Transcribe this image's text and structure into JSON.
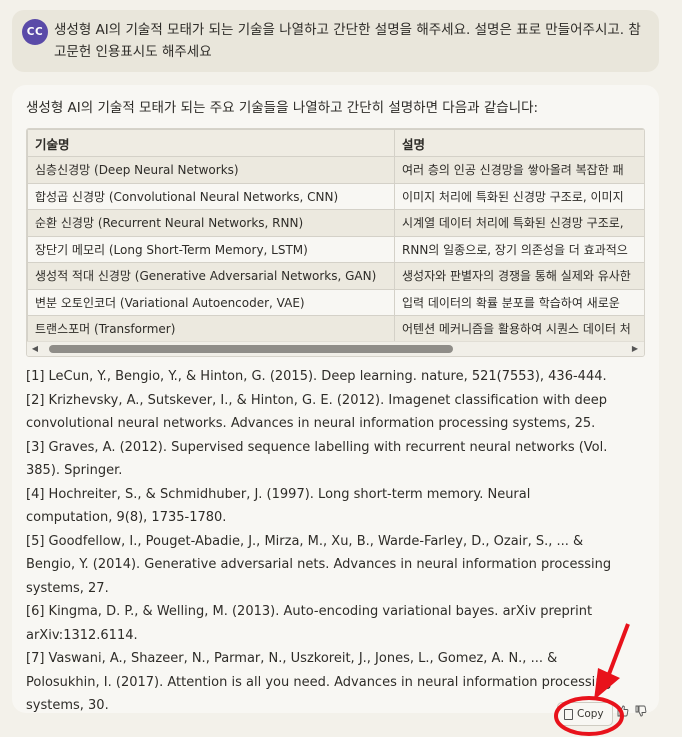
{
  "user_message": {
    "avatar_initials": "CC",
    "text": "생성형 AI의 기술적 모태가 되는 기술을 나열하고 간단한 설명을 해주세요. 설명은 표로 만들어주시고. 참고문헌 인용표시도 해주세요"
  },
  "assistant": {
    "intro": "생성형 AI의 기술적 모태가 되는 주요 기술들을 나열하고 간단히 설명하면 다음과 같습니다:",
    "table": {
      "headers": [
        "기술명",
        "설명"
      ],
      "rows": [
        [
          "심층신경망 (Deep Neural Networks)",
          "여러 층의 인공 신경망을 쌓아올려 복잡한 패"
        ],
        [
          "합성곱 신경망 (Convolutional Neural Networks, CNN)",
          "이미지 처리에 특화된 신경망 구조로, 이미지"
        ],
        [
          "순환 신경망 (Recurrent Neural Networks, RNN)",
          "시계열 데이터 처리에 특화된 신경망 구조로,"
        ],
        [
          "장단기 메모리 (Long Short-Term Memory, LSTM)",
          "RNN의 일종으로, 장기 의존성을 더 효과적으"
        ],
        [
          "생성적 적대 신경망 (Generative Adversarial Networks, GAN)",
          "생성자와 판별자의 경쟁을 통해 실제와 유사한"
        ],
        [
          "변분 오토인코더 (Variational Autoencoder, VAE)",
          "입력 데이터의 확률 분포를 학습하여 새로운"
        ],
        [
          "트랜스포머 (Transformer)",
          "어텐션 메커니즘을 활용하여 시퀀스 데이터 처"
        ]
      ]
    },
    "references": [
      "[1] LeCun, Y., Bengio, Y., & Hinton, G. (2015). Deep learning. nature, 521(7553), 436-444.",
      "[2] Krizhevsky, A., Sutskever, I., & Hinton, G. E. (2012). Imagenet classification with deep convolutional neural networks. Advances in neural information processing systems, 25.",
      "[3] Graves, A. (2012). Supervised sequence labelling with recurrent neural networks (Vol. 385). Springer.",
      "[4] Hochreiter, S., & Schmidhuber, J. (1997). Long short-term memory. Neural computation, 9(8), 1735-1780.",
      "[5] Goodfellow, I., Pouget-Abadie, J., Mirza, M., Xu, B., Warde-Farley, D., Ozair, S., ... & Bengio, Y. (2014). Generative adversarial nets. Advances in neural information processing systems, 27.",
      "[6] Kingma, D. P., & Welling, M. (2013). Auto-encoding variational bayes. arXiv preprint arXiv:1312.6114.",
      "[7] Vaswani, A., Shazeer, N., Parmar, N., Uszkoreit, J., Jones, L., Gomez, A. N., ... & Polosukhin, I. (2017). Attention is all you need. Advances in neural information processing systems, 30."
    ],
    "actions": {
      "copy_label": "Copy"
    }
  },
  "annotation_color": "#e8121b",
  "icons": [
    "clipboard-icon",
    "thumbs-up-icon",
    "thumbs-down-icon",
    "scroll-left-icon",
    "scroll-right-icon"
  ]
}
